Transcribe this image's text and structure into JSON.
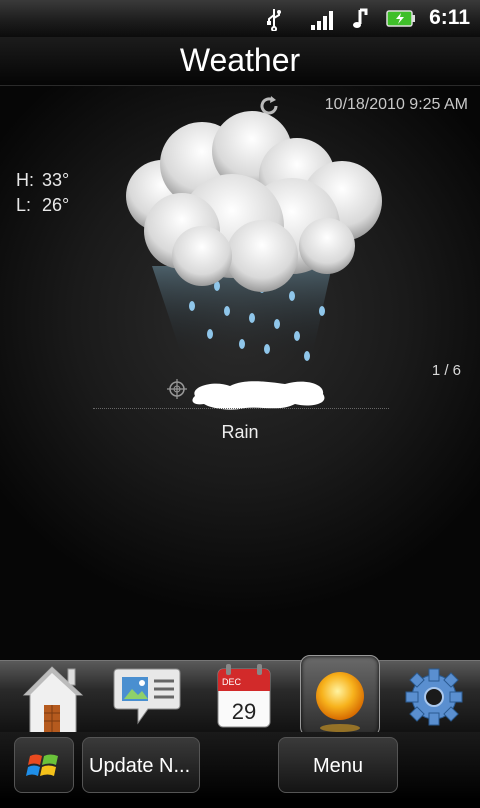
{
  "status_bar": {
    "time": "6:11",
    "icons": [
      "usb-icon",
      "signal-icon",
      "music-note-icon",
      "battery-charging-icon"
    ]
  },
  "header": {
    "title": "Weather"
  },
  "weather": {
    "timestamp": "10/18/2010 9:25 AM",
    "high_label": "H:",
    "high_value": "33°",
    "low_label": "L:",
    "low_value": "26°",
    "page_counter": "1 / 6",
    "condition": "Rain",
    "condition_icon": "rain-cloud-icon"
  },
  "dock": {
    "items": [
      "home-icon",
      "messages-icon",
      "calendar-icon",
      "weather-sun-icon",
      "settings-icon"
    ],
    "calendar_month": "DEC",
    "calendar_day": "29",
    "selected": "weather-sun-icon"
  },
  "bottom_bar": {
    "update_label": "Update N...",
    "menu_label": "Menu"
  },
  "colors": {
    "background": "#000000",
    "text": "#ffffff",
    "battery": "#3fbf2a",
    "calendar_red": "#d22a2a"
  }
}
